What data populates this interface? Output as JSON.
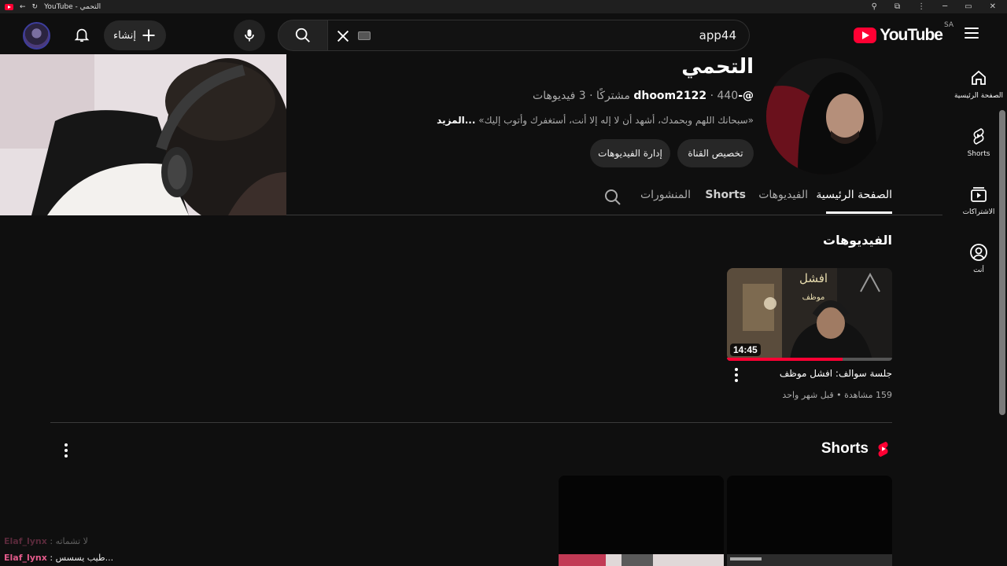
{
  "browser": {
    "tab_title": "YouTube - التحمي",
    "win_min": "─",
    "win_max": "▭",
    "win_close": "✕"
  },
  "topbar": {
    "logo_text": "YouTube",
    "country_code": "SA",
    "search_value": "app44",
    "create_label": "إنشاء"
  },
  "rail": {
    "items": [
      {
        "label": "الصفحة الرئيسية",
        "icon": "home-icon"
      },
      {
        "label": "Shorts",
        "icon": "shorts-icon"
      },
      {
        "label": "الاشتراكات",
        "icon": "subscriptions-icon"
      },
      {
        "label": "أنت",
        "icon": "you-icon"
      }
    ]
  },
  "channel": {
    "name": "التحمي",
    "handle": "@-dhoom2122",
    "stats": "· 440 مشتركًا · 3 فيديوهات",
    "description": "«سبحانك اللهم وبحمدك، أشهد أن لا إله إلا أنت، أستغفرك وأتوب إليك»",
    "more": "...المزيد",
    "customize_label": "تخصيص القناة",
    "manage_label": "إدارة الفيديوهات"
  },
  "tabs": {
    "home": "الصفحة الرئيسية",
    "videos": "الفيديوهات",
    "shorts": "Shorts",
    "posts": "المنشورات"
  },
  "videos_section": {
    "title": "الفيديوهات",
    "video": {
      "title": "جلسة سوالف: افشل موظف",
      "meta": "159 مشاهدة • قبل شهر واحد",
      "duration": "14:45",
      "thumb_text_big": "افشل",
      "thumb_text_small": "موظف",
      "watched_fraction": 0.7
    }
  },
  "shorts_section": {
    "title": "Shorts"
  },
  "chat_overlay": [
    {
      "user": "Elaf_lynx",
      "msg": ": لا تشماته"
    },
    {
      "user": "Elaf_lynx",
      "msg": ": طيب يسسس..."
    }
  ],
  "colors": {
    "accent": "#ff0033",
    "background": "#0f0f0f",
    "chip": "#272727"
  }
}
